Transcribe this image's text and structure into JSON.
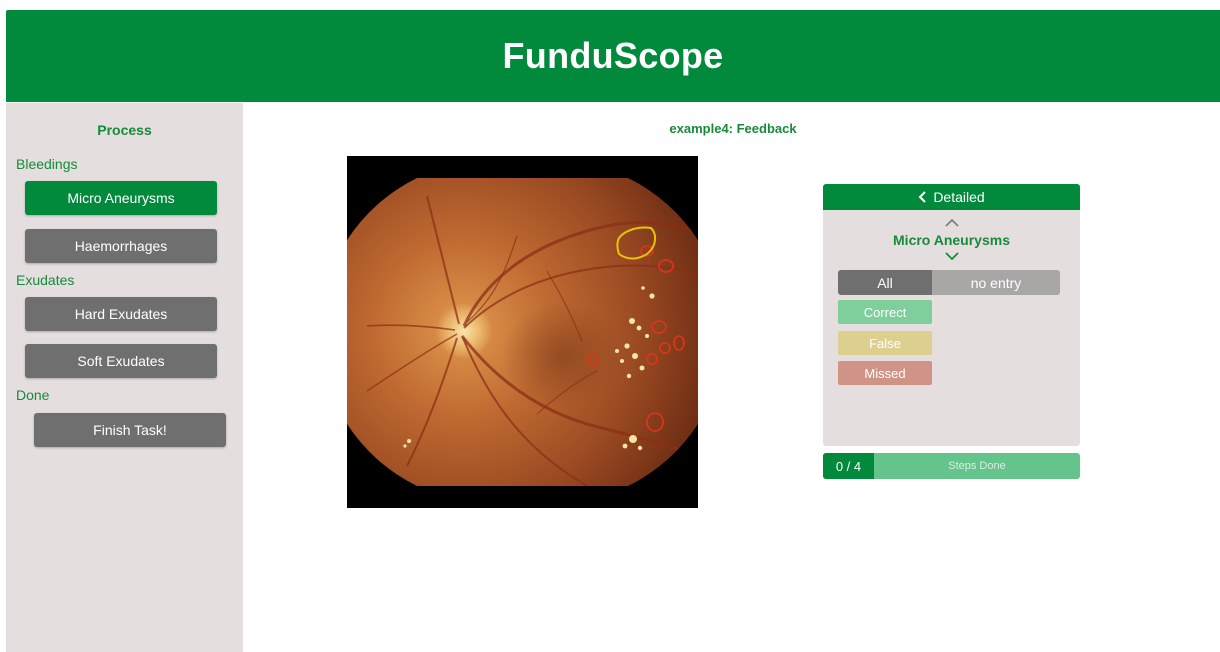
{
  "app": {
    "title": "FunduScope"
  },
  "sidebar": {
    "title": "Process",
    "categories": [
      {
        "label": "Bleedings"
      },
      {
        "label": "Exudates"
      },
      {
        "label": "Done"
      }
    ],
    "items": [
      {
        "label": "Micro Aneurysms",
        "active": true
      },
      {
        "label": "Haemorrhages",
        "active": false
      },
      {
        "label": "Hard Exudates",
        "active": false
      },
      {
        "label": "Soft Exudates",
        "active": false
      },
      {
        "label": "Finish Task!",
        "active": false
      }
    ]
  },
  "main": {
    "task_title": "example4: Feedback",
    "image_alt": "retina fundus image with annotations"
  },
  "panel": {
    "header_label": "Detailed",
    "category": "Micro Aneurysms",
    "filter": {
      "all_label": "All",
      "none_label": "no entry",
      "selected": "All"
    },
    "legend": [
      {
        "label": "Correct",
        "color": "#7fcf9d"
      },
      {
        "label": "False",
        "color": "#ddd08f"
      },
      {
        "label": "Missed",
        "color": "#cf9486"
      }
    ],
    "steps": {
      "count": "0 / 4",
      "label": "Steps Done"
    }
  },
  "colors": {
    "brand": "#028a3c",
    "sidebar_bg": "#e5dede",
    "button_gray": "#6f6f6f",
    "annotation_user": "#e8c400",
    "annotation_ref": "#e0341a"
  }
}
